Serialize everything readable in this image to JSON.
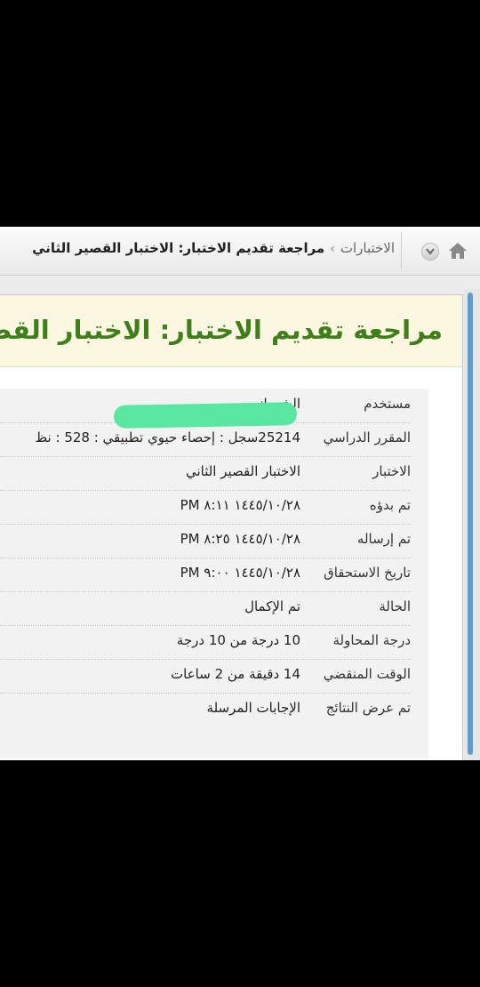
{
  "breadcrumb": {
    "root": "الاختبارات",
    "separator": "›",
    "current": "مراجعة تقديم الاختبار: الاختبار القصير الثاني"
  },
  "page_title": "مراجعة تقديم الاختبار: الاختبار القصير الثاني",
  "details": [
    {
      "label": "مستخدم",
      "value": "الشهراني"
    },
    {
      "label": "المقرر الدراسي",
      "value": "25214سجل : إحصاء حيوي تطبيقي : 528 : نظ"
    },
    {
      "label": "الاختبار",
      "value": "الاختبار القصير الثاني"
    },
    {
      "label": "تم بدؤه",
      "value": "١٤٤٥/١٠/٢٨ ٨:١١ PM"
    },
    {
      "label": "تم إرساله",
      "value": "١٤٤٥/١٠/٢٨ ٨:٢٥ PM"
    },
    {
      "label": "تاريخ الاستحقاق",
      "value": "١٤٤٥/١٠/٢٨ ٩:٠٠ PM"
    },
    {
      "label": "الحالة",
      "value": "تم الإكمال"
    },
    {
      "label": "درجة المحاولة",
      "value": "10 درجة من 10 درجة"
    },
    {
      "label": "الوقت المنقضي",
      "value": "14 دقيقة من 2 ساعات"
    },
    {
      "label": "تم عرض النتائج",
      "value": "الإجابات المرسلة"
    }
  ],
  "colors": {
    "title": "#3e7f1a",
    "title_bg": "#fbf7e1",
    "redaction": "#58e6a0"
  }
}
